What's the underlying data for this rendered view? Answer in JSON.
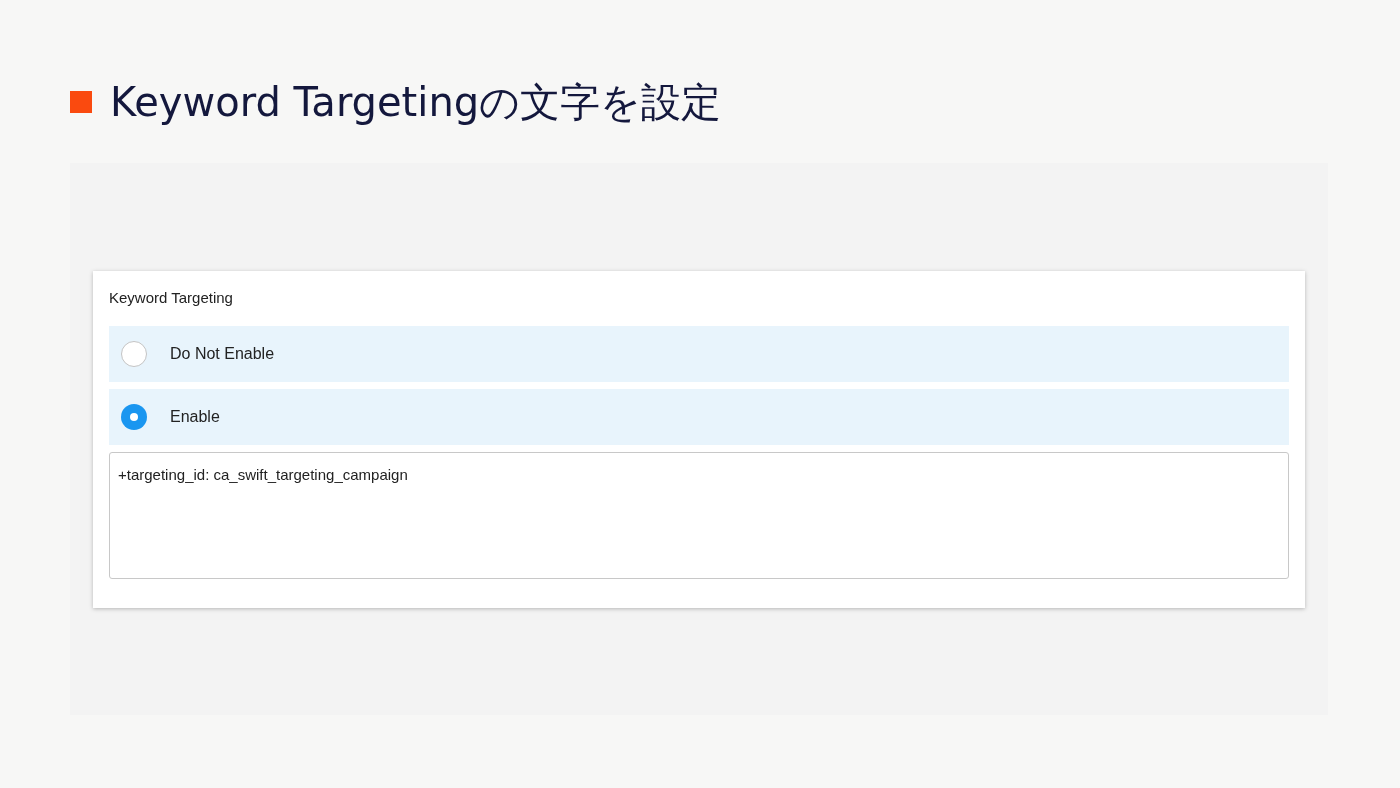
{
  "heading": {
    "title": "Keyword Targetingの文字を設定"
  },
  "form": {
    "label": "Keyword Targeting",
    "options": [
      {
        "label": "Do Not Enable",
        "selected": false
      },
      {
        "label": "Enable",
        "selected": true
      }
    ],
    "text_area": {
      "value": "+targeting_id: ca_swift_targeting_campaign"
    }
  }
}
